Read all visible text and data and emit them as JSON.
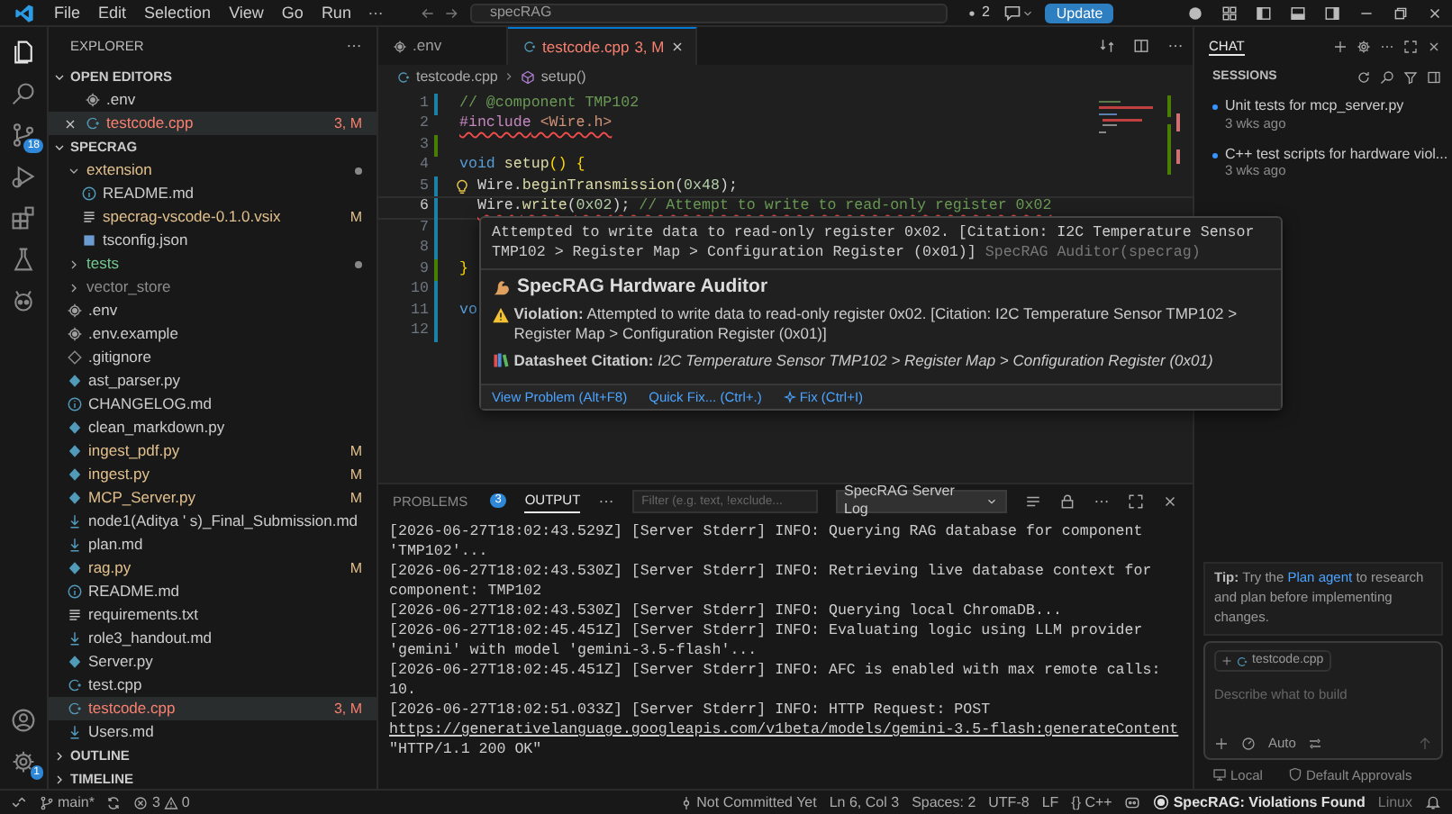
{
  "title_bar": {
    "menu": [
      "File",
      "Edit",
      "Selection",
      "View",
      "Go",
      "Run"
    ],
    "command_center": "specRAG",
    "notification_count": "2",
    "update_button": "Update"
  },
  "activity_bar": {
    "scm_badge": "18",
    "settings_badge": "1"
  },
  "sidebar": {
    "title": "EXPLORER",
    "open_editors": {
      "title": "OPEN EDITORS",
      "expanded": true,
      "items": [
        {
          "name": ".env",
          "kind": "settings",
          "color": "#cccccc",
          "selected": false
        },
        {
          "name": "testcode.cpp",
          "kind": "cpp",
          "color": "#f88070",
          "badge": "3, M",
          "selected": true
        }
      ]
    },
    "root": {
      "title": "SPECRAG",
      "expanded": true,
      "items": [
        {
          "name": "extension",
          "kind": "folder",
          "expanded": true,
          "color": "#e2c08d",
          "dot": true,
          "selected": false,
          "children": [
            {
              "name": "README.md",
              "kind": "info",
              "color": "#cccccc",
              "selected": false
            },
            {
              "name": "specrag-vscode-0.1.0.vsix",
              "kind": "text",
              "color": "#e2c08d",
              "badge": "M",
              "selected": false
            },
            {
              "name": "tsconfig.json",
              "kind": "json",
              "color": "#cccccc",
              "selected": false
            }
          ]
        },
        {
          "name": "tests",
          "kind": "folder",
          "expanded": false,
          "color": "#73c991",
          "dot": true,
          "selected": false
        },
        {
          "name": "vector_store",
          "kind": "folder",
          "expanded": false,
          "color": "#8c8c8c",
          "selected": false
        },
        {
          "name": ".env",
          "kind": "settings",
          "color": "#cccccc",
          "selected": false
        },
        {
          "name": ".env.example",
          "kind": "settings",
          "color": "#cccccc",
          "selected": false
        },
        {
          "name": ".gitignore",
          "kind": "git",
          "color": "#cccccc",
          "selected": false
        },
        {
          "name": "ast_parser.py",
          "kind": "python",
          "color": "#cccccc",
          "selected": false
        },
        {
          "name": "CHANGELOG.md",
          "kind": "info",
          "color": "#cccccc",
          "selected": false
        },
        {
          "name": "clean_markdown.py",
          "kind": "python",
          "color": "#cccccc",
          "selected": false
        },
        {
          "name": "ingest_pdf.py",
          "kind": "python",
          "color": "#e2c08d",
          "badge": "M",
          "selected": false
        },
        {
          "name": "ingest.py",
          "kind": "python",
          "color": "#e2c08d",
          "badge": "M",
          "selected": false
        },
        {
          "name": "MCP_Server.py",
          "kind": "python",
          "color": "#e2c08d",
          "badge": "M",
          "selected": false
        },
        {
          "name": "node1(Aditya ' s)_Final_Submission.md",
          "kind": "markdown",
          "color": "#cccccc",
          "selected": false
        },
        {
          "name": "plan.md",
          "kind": "markdown",
          "color": "#cccccc",
          "selected": false
        },
        {
          "name": "rag.py",
          "kind": "python",
          "color": "#e2c08d",
          "badge": "M",
          "selected": false
        },
        {
          "name": "README.md",
          "kind": "info",
          "color": "#cccccc",
          "selected": false
        },
        {
          "name": "requirements.txt",
          "kind": "text",
          "color": "#cccccc",
          "selected": false
        },
        {
          "name": "role3_handout.md",
          "kind": "markdown",
          "color": "#cccccc",
          "selected": false
        },
        {
          "name": "Server.py",
          "kind": "python",
          "color": "#cccccc",
          "selected": false
        },
        {
          "name": "test.cpp",
          "kind": "cpp",
          "color": "#cccccc",
          "selected": false
        },
        {
          "name": "testcode.cpp",
          "kind": "cpp",
          "color": "#f88070",
          "badge": "3, M",
          "selected": true
        },
        {
          "name": "Users.md",
          "kind": "markdown",
          "color": "#cccccc",
          "selected": false
        }
      ]
    },
    "sections": [
      {
        "title": "OUTLINE",
        "expanded": false
      },
      {
        "title": "TIMELINE",
        "expanded": false
      }
    ]
  },
  "editor": {
    "tabs": [
      {
        "name": ".env",
        "kind": "settings",
        "color": "#9d9d9d",
        "selected": false
      },
      {
        "name": "testcode.cpp",
        "kind": "cpp",
        "color": "#f88070",
        "badge": "3, M",
        "selected": true
      }
    ],
    "breadcrumb": [
      {
        "text": "testcode.cpp",
        "kind": "cpp"
      },
      {
        "text": "setup()",
        "kind": "method"
      }
    ],
    "lines": [
      {
        "n": "1",
        "color": "#1b81a8",
        "tokens": [
          {
            "text": "// @component TMP102",
            "kind": "comment"
          }
        ]
      },
      {
        "n": "2",
        "error": true,
        "tokens": [
          {
            "text": "#include",
            "kind": "preproc"
          },
          {
            "text": " <Wire.h>",
            "kind": "string"
          }
        ]
      },
      {
        "n": "3",
        "color": "#487e02"
      },
      {
        "n": "4",
        "tokens": [
          {
            "text": "void",
            "kind": "keyword"
          },
          {
            "text": " setup",
            "kind": "func"
          },
          {
            "text": "() {",
            "kind": "paren"
          }
        ]
      },
      {
        "n": "5",
        "color": "#1b81a8",
        "lightbulb": true,
        "indented": true,
        "tokens": [
          {
            "text": "Wire",
            "kind": "plain"
          },
          {
            "text": ".",
            "kind": "plain"
          },
          {
            "text": "beginTransmission",
            "kind": "func"
          },
          {
            "text": "(",
            "kind": "plain"
          },
          {
            "text": "0x48",
            "kind": "number"
          },
          {
            "text": ");",
            "kind": "plain"
          }
        ]
      },
      {
        "n": "6",
        "color": "#1b81a8",
        "current": true,
        "error": true,
        "indented": true,
        "tokens": [
          {
            "text": "Wire",
            "kind": "plain"
          },
          {
            "text": ".",
            "kind": "plain"
          },
          {
            "text": "write",
            "kind": "func"
          },
          {
            "text": "(",
            "kind": "plain"
          },
          {
            "text": "0x02",
            "kind": "number"
          },
          {
            "text": "); ",
            "kind": "plain"
          },
          {
            "text": "// Attempt to write to read-only register 0x02",
            "kind": "comment"
          }
        ]
      },
      {
        "n": "7",
        "color": "#1b81a8"
      },
      {
        "n": "8",
        "color": "#1b81a8"
      },
      {
        "n": "9",
        "color": "#487e02",
        "tokens": [
          {
            "text": "}",
            "kind": "paren"
          }
        ]
      },
      {
        "n": "10",
        "color": "#1b81a8"
      },
      {
        "n": "11",
        "color": "#1b81a8",
        "tokens": [
          {
            "text": "vo",
            "kind": "keyword"
          }
        ]
      },
      {
        "n": "12",
        "color": "#1b81a8"
      }
    ]
  },
  "hover": {
    "diagnostic": "Attempted to write data to read-only register 0x02. [Citation: I2C Temperature Sensor TMP102 > Register Map > Configuration Register (0x01)]",
    "source": "SpecRAG Auditor(specrag)",
    "heading": "SpecRAG Hardware Auditor",
    "violation": "**Violation:** Attempted to write data to read-only register 0x02. [Citation: I2C Temperature Sensor TMP102 > Register Map > Configuration Register (0x01)]",
    "citation": "**Datasheet Citation:** *I2C Temperature Sensor TMP102 > Register Map > Configuration Register (0x01)*",
    "actions": [
      {
        "label": "View Problem (Alt+F8)",
        "kind": "plain"
      },
      {
        "label": "Quick Fix... (Ctrl+.)",
        "kind": "plain"
      },
      {
        "label": "Fix (Ctrl+I)",
        "kind": "ai"
      }
    ]
  },
  "panel": {
    "tabs": [
      {
        "label": "PROBLEMS",
        "badge": "3",
        "selected": false
      },
      {
        "label": "OUTPUT",
        "selected": true
      }
    ],
    "filter_placeholder": "Filter (e.g. text, !exclude...",
    "channel": "SpecRAG Server Log",
    "log": [
      {
        "text": "[2026-06-27T18:02:43.529Z] [Server Stderr] INFO: Querying RAG database for component 'TMP102'..."
      },
      {
        "text": "[2026-06-27T18:02:43.530Z] [Server Stderr] INFO: Retrieving live database context for component: TMP102"
      },
      {
        "text": "[2026-06-27T18:02:43.530Z] [Server Stderr] INFO: Querying local ChromaDB..."
      },
      {
        "text": "[2026-06-27T18:02:45.451Z] [Server Stderr] INFO: Evaluating logic using LLM provider 'gemini' with model 'gemini-3.5-flash'..."
      },
      {
        "text": "[2026-06-27T18:02:45.451Z] [Server Stderr] INFO: AFC is enabled with max remote calls: 10."
      },
      {
        "text": "[2026-06-27T18:02:51.033Z] [Server Stderr] INFO: HTTP Request: POST",
        "link": "https://generativelanguage.googleapis.com/v1beta/models/gemini-3.5-flash:generateContent",
        "after": "\"HTTP/1.1 200 OK\""
      }
    ]
  },
  "chat": {
    "tab": "CHAT",
    "sessions_title": "SESSIONS",
    "sessions": [
      {
        "title": "Unit tests for mcp_server.py",
        "time": "3 wks ago"
      },
      {
        "title": "C++ test scripts for hardware viol...",
        "time": "3 wks ago"
      }
    ],
    "tip": {
      "label": "Tip:",
      "before": "Try the",
      "link": "Plan agent",
      "after": "to research and plan before implementing changes."
    },
    "input": {
      "attachment": "testcode.cpp",
      "placeholder": "Describe what to build",
      "mode": "Auto"
    },
    "footer": [
      {
        "text": "Local",
        "kind": "monitor"
      },
      {
        "text": "Default Approvals",
        "kind": "shield"
      }
    ]
  },
  "status_bar": {
    "branch": "main*",
    "errors": "3",
    "warnings": "0",
    "right": [
      {
        "kind": "blame",
        "text": "Not Committed Yet"
      },
      {
        "kind": "text",
        "text": "Ln 6, Col 3"
      },
      {
        "kind": "text",
        "text": "Spaces: 2"
      },
      {
        "kind": "text",
        "text": "UTF-8"
      },
      {
        "kind": "text",
        "text": "LF"
      },
      {
        "kind": "text",
        "text": "{} C++"
      },
      {
        "kind": "copilot"
      },
      {
        "kind": "alert",
        "text": "SpecRAG: Violations Found"
      },
      {
        "kind": "dim",
        "text": "Linux"
      },
      {
        "kind": "bell"
      }
    ]
  }
}
